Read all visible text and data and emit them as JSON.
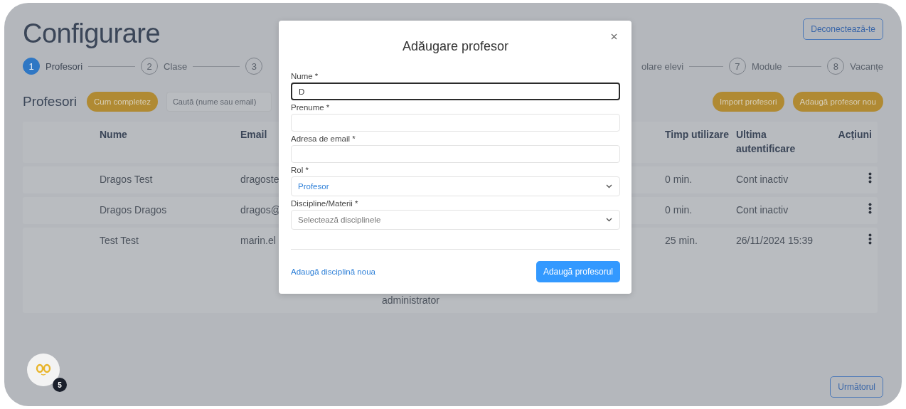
{
  "header": {
    "title": "Configurare",
    "logout_button": "Deconectează-te"
  },
  "steps": [
    {
      "number": "1",
      "label": "Profesori",
      "selected": true
    },
    {
      "number": "2",
      "label": "Clase",
      "selected": false
    },
    {
      "number": "3",
      "selected": false
    },
    {
      "label": "olare elevi",
      "selected": false
    },
    {
      "number": "7",
      "label": "Module",
      "selected": false
    },
    {
      "number": "8",
      "label": "Vacanțe",
      "selected": false
    }
  ],
  "section": {
    "title": "Profesori",
    "help_button": "Cum completez",
    "search": {
      "placeholder": "Caută (nume sau email)"
    },
    "import_button": "Import profesori",
    "add_button": "Adaugă profesor nou"
  },
  "table": {
    "columns": [
      "Nume",
      "Email",
      "Timp utilizare",
      "Ultima autentificare",
      "Acțiuni"
    ],
    "rows": [
      {
        "name": "Dragos Test",
        "email": "dragoste",
        "time": "0 min.",
        "last_login": "Cont inactiv"
      },
      {
        "name": "Dragos Dragos",
        "email": "dragos@",
        "time": "0 min.",
        "last_login": "Cont inactiv"
      },
      {
        "name": "Test Test",
        "email": "marin.el",
        "note": "administrator",
        "time": "25 min.",
        "last_login": "26/11/2024 15:39"
      }
    ]
  },
  "chat_widget": {
    "badge": "5"
  },
  "next_button": "Următorul",
  "modal": {
    "title": "Adăugare profesor",
    "fields": [
      {
        "kind": "text",
        "label": "Nume *",
        "value": "D",
        "focused": true
      },
      {
        "kind": "text",
        "label": "Prenume *",
        "focused": false
      },
      {
        "kind": "text",
        "label": "Adresa de email *",
        "focused": false
      },
      {
        "kind": "select",
        "label": "Rol *",
        "value": "Profesor",
        "focused": false
      },
      {
        "kind": "select",
        "label": "Discipline/Materii *",
        "placeholder": "Selectează disciplinele",
        "focused": false
      }
    ],
    "link": "Adaugă disciplină noua",
    "submit_button": "Adaugă profesorul"
  }
}
